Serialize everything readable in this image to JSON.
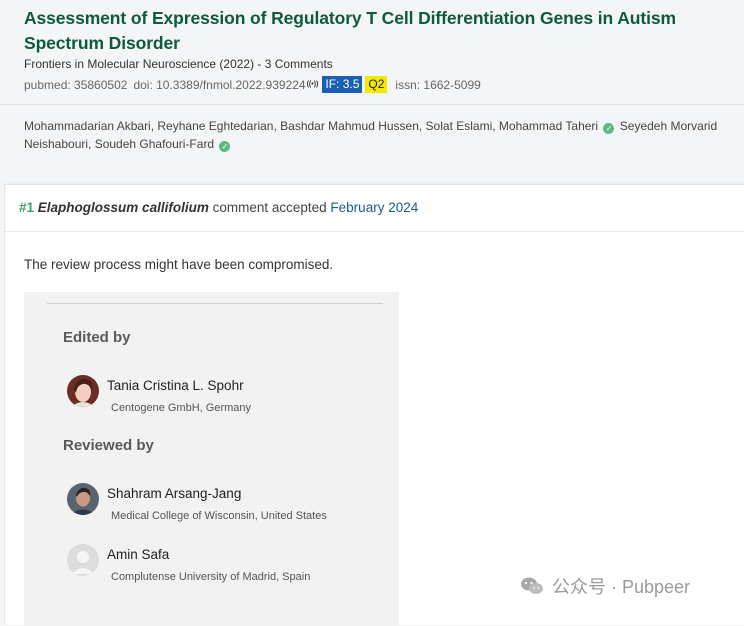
{
  "article": {
    "title": "Assessment of Expression of Regulatory T Cell Differentiation Genes in Autism Spectrum Disorder",
    "journal_line": "Frontiers in Molecular Neuroscience (2022) - 3 Comments",
    "pubmed": "pubmed: 35860502",
    "doi": "doi: 10.3389/fnmol.2022.939224",
    "altmetric_icon": "altmetric-icon",
    "impact_factor": "IF: 3.5",
    "quartile": "Q2",
    "issn": "issn: 1662-5099",
    "authors_part1": "Mohammadarian Akbari, Reyhane Eghtedarian, Bashdar Mahmud Hussen, Solat Eslami, Mohammad Taheri",
    "authors_part2": "Seyedeh Morvarid Neishabouri, Soudeh Ghafouri-Fard",
    "colors": {
      "title": "#0f5a3e",
      "if_badge": "#1a5fb4",
      "q_badge": "#f4ea00",
      "verified": "#5fb88a"
    }
  },
  "comment": {
    "number": "#1",
    "author": "Elaphoglossum callifolium",
    "action": "comment accepted",
    "date": "February 2024",
    "body": "The review process might have been compromised.",
    "panel": {
      "edited_by_heading": "Edited by",
      "reviewed_by_heading": "Reviewed by",
      "editor": {
        "name": "Tania Cristina L. Spohr",
        "affiliation": "Centogene GmbH, Germany"
      },
      "reviewers": [
        {
          "name": "Shahram Arsang-Jang",
          "affiliation": "Medical College of Wisconsin, United States"
        },
        {
          "name": "Amin Safa",
          "affiliation": "Complutense University of Madrid, Spain"
        }
      ]
    }
  },
  "watermark": {
    "text": "公众号 · Pubpeer",
    "icon": "wechat-icon"
  }
}
